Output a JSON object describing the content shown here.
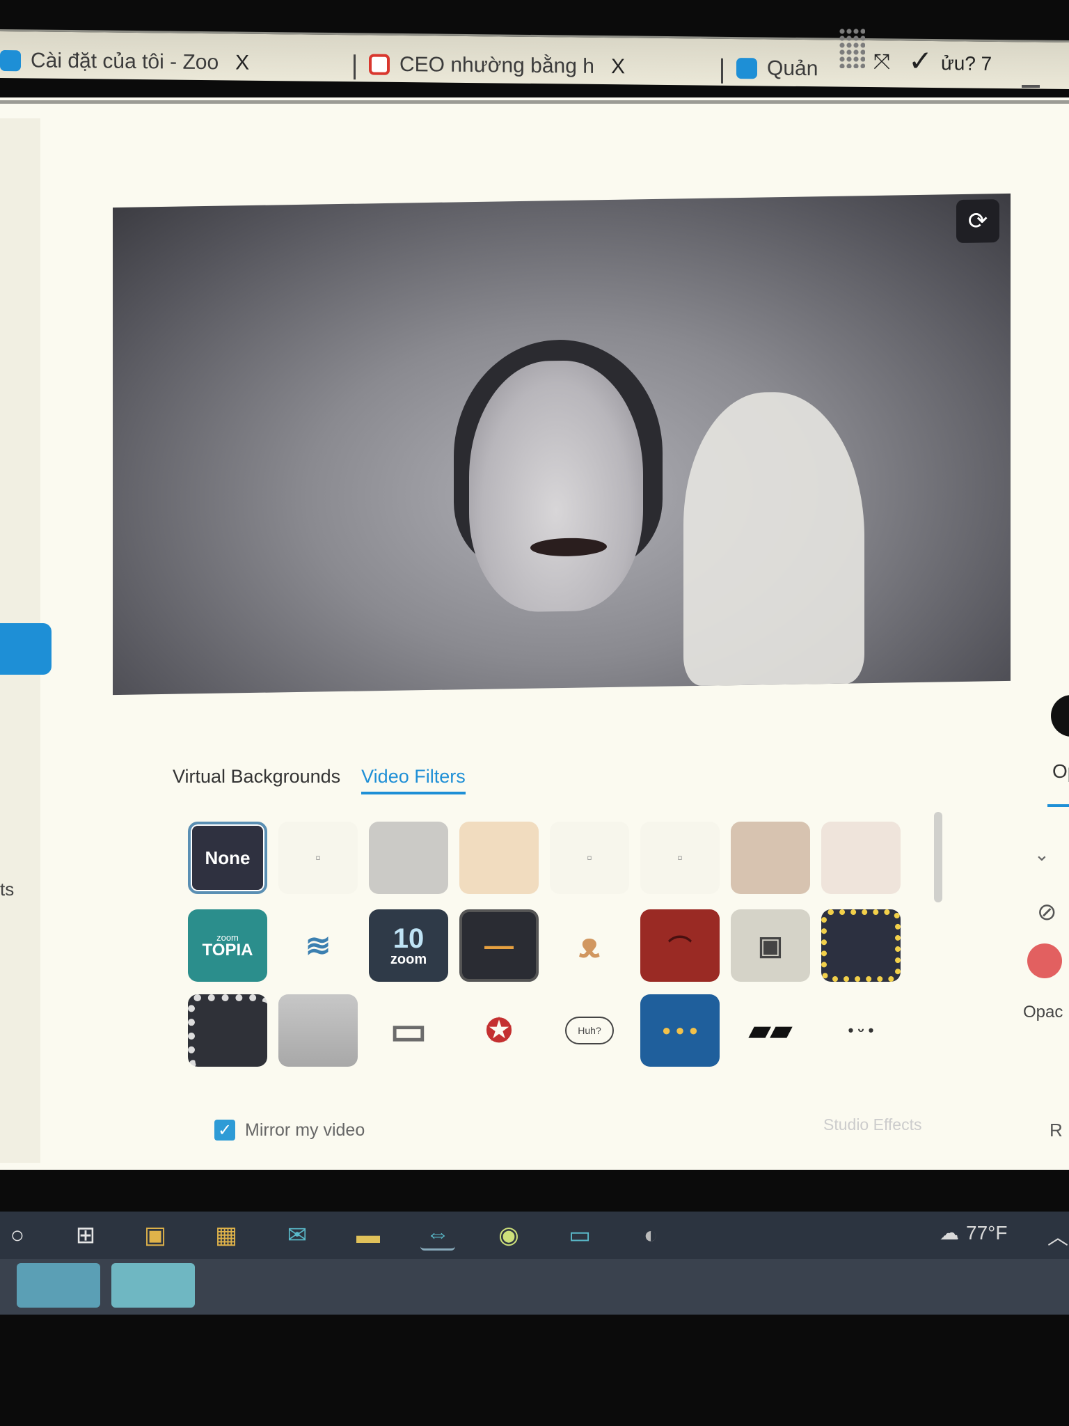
{
  "browser": {
    "tabs": [
      {
        "title": "Cài đặt của tôi - Zoo",
        "icon": "zoom-icon",
        "color": "#1e8fd6"
      },
      {
        "title": "CEO nhường bằng h",
        "icon": "google-icon",
        "color": "#d9372e"
      },
      {
        "title": "Quản",
        "icon": "zoom-icon",
        "color": "#1e8fd6"
      }
    ],
    "close_symbol": "X",
    "extra_text": "ửu? 7"
  },
  "settings": {
    "background_tabs": [
      {
        "label": "Virtual Backgrounds",
        "active": false
      },
      {
        "label": "Video Filters",
        "active": true
      }
    ],
    "filter_none_label": "None",
    "filters_row1": [
      "none",
      "filter-2",
      "filter-3",
      "filter-4",
      "filter-5",
      "filter-6",
      "filter-7",
      "filter-8"
    ],
    "filters_row2": [
      "zoomtopia",
      "whale",
      "zoom-10",
      "retro-tv",
      "bear",
      "theater",
      "old-tv",
      "sunflower-frame"
    ],
    "filters_row3": [
      "film-strip",
      "clouds",
      "vintage-tv",
      "ribbon-badge",
      "speech-bubble",
      "party-lights",
      "sunglasses",
      "cute-face"
    ],
    "zoom10_number": "10",
    "zoom10_text": "zoom",
    "zoomtopia_top": "zoom",
    "zoomtopia_main": "TOPIA",
    "speech_bubble_text": "Huh?",
    "mirror_label": "Mirror my video",
    "mirror_checked": true,
    "studio_effects_label": "Studio Effects",
    "right_partial_tab": "Op",
    "right_partial_opacity": "Opac",
    "right_partial_r": "R",
    "side_partial_text": "ts"
  },
  "taskbar": {
    "temperature": "77°F",
    "items": [
      "search-icon",
      "task-view-icon",
      "store-icon",
      "app-icon",
      "mail-icon",
      "folder-icon",
      "teamviewer-icon",
      "browser-icon",
      "zoom-icon",
      "app2-icon"
    ]
  },
  "colors": {
    "accent": "#1e8fd6",
    "window_bg": "#fbfaf0",
    "taskbar_bg": "#2c3440"
  }
}
